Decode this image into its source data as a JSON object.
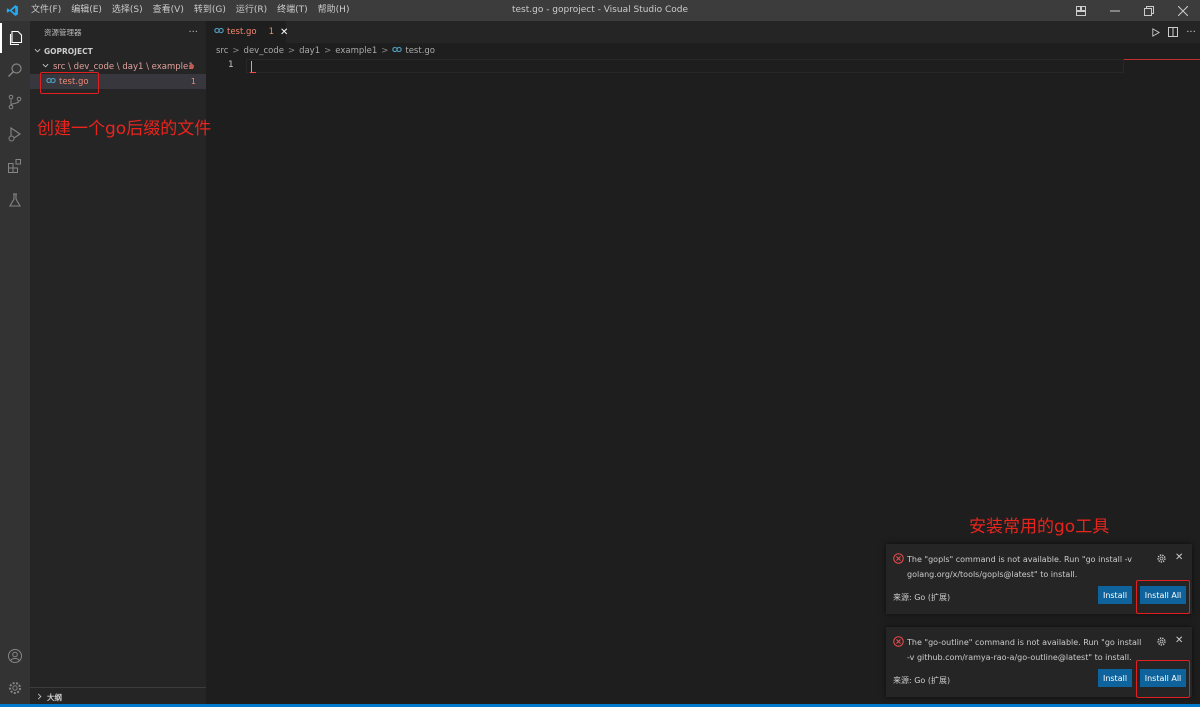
{
  "titlebar": {
    "title": "test.go - goproject - Visual Studio Code",
    "menu": [
      "文件(F)",
      "编辑(E)",
      "选择(S)",
      "查看(V)",
      "转到(G)",
      "运行(R)",
      "终端(T)",
      "帮助(H)"
    ]
  },
  "activitybar": {
    "icons": [
      "explorer-icon",
      "search-icon",
      "source-control-icon",
      "run-debug-icon",
      "extensions-icon",
      "testing-icon",
      "account-icon",
      "settings-gear-icon"
    ]
  },
  "sidebar": {
    "header": "资源管理器",
    "more": "···",
    "section": "GOPROJECT",
    "folder_path": "src \\ dev_code \\ day1 \\ example1",
    "file_name": "test.go",
    "file_errors": "1",
    "outline": "大纲"
  },
  "editor": {
    "tab_label": "test.go",
    "tab_problems": "1",
    "breadcrumb": [
      "src",
      "dev_code",
      "day1",
      "example1",
      "test.go"
    ],
    "line_number": "1"
  },
  "notifications": [
    {
      "message": "The \"gopls\" command is not available. Run \"go install -v golang.org/x/tools/gopls@latest\" to install.",
      "source": "来源: Go (扩展)",
      "install": "Install",
      "install_all": "Install All"
    },
    {
      "message": "The \"go-outline\" command is not available. Run \"go install -v github.com/ramya-rao-a/go-outline@latest\" to install.",
      "source": "来源: Go (扩展)",
      "install": "Install",
      "install_all": "Install All"
    }
  ],
  "annotations": {
    "create_file": "创建一个go后缀的文件",
    "install_tools": "安装常用的go工具"
  },
  "colors": {
    "accent": "#007acc",
    "error": "#f48771",
    "annotation": "#e8241d",
    "button": "#0e639c"
  }
}
